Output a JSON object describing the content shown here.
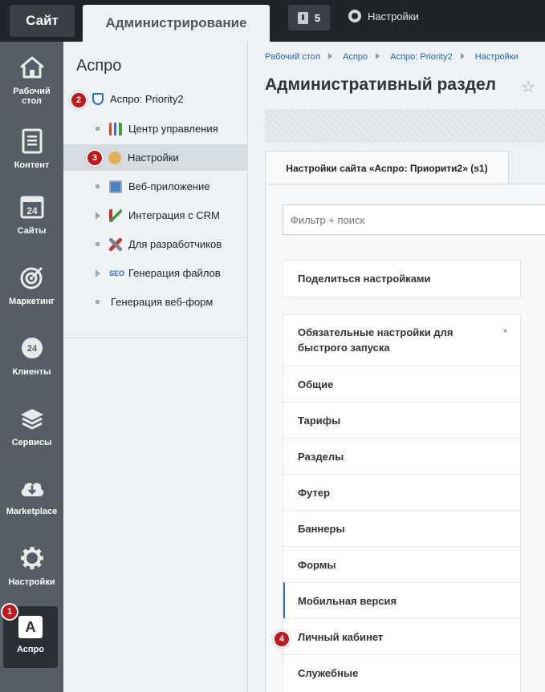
{
  "topbar": {
    "site_tab": "Сайт",
    "admin_tab": "Администрирование",
    "notifications_count": "5",
    "settings_label": "Настройки"
  },
  "leftnav": {
    "items": [
      {
        "label": "Рабочий стол",
        "icon": "home-icon"
      },
      {
        "label": "Контент",
        "icon": "document-icon"
      },
      {
        "label": "Сайты",
        "icon": "calendar-24-icon"
      },
      {
        "label": "Маркетинг",
        "icon": "target-icon"
      },
      {
        "label": "Клиенты",
        "icon": "clients-24-icon"
      },
      {
        "label": "Сервисы",
        "icon": "layers-icon"
      },
      {
        "label": "Marketplace",
        "icon": "cloud-download-icon"
      },
      {
        "label": "Настройки",
        "icon": "gear-icon"
      },
      {
        "label": "Аспро",
        "icon": "aspro-a-icon"
      }
    ],
    "active_label_line": "Аспро",
    "aspro_letter": "A"
  },
  "sub": {
    "title": "Аспро",
    "items": [
      {
        "label": "Аспро: Priority2"
      },
      {
        "label": "Центр управления"
      },
      {
        "label": "Настройки"
      },
      {
        "label": "Веб-приложение"
      },
      {
        "label": "Интеграция с CRM"
      },
      {
        "label": "Для разработчиков"
      },
      {
        "label": "Генерация файлов"
      },
      {
        "label": "Генерация веб-форм"
      }
    ]
  },
  "main": {
    "breadcrumbs": [
      "Рабочий стол",
      "Аспро",
      "Аспро: Priority2",
      "Настройки"
    ],
    "title": "Административный раздел",
    "site_tab": "Настройки сайта «Аспро: Приорити2» (s1)",
    "search_placeholder": "Фильтр + поиск",
    "share_label": "Поделиться настройками",
    "required_star": "*",
    "sections": [
      "Обязательные настройки для быстрого запуска",
      "Общие",
      "Тарифы",
      "Разделы",
      "Футер",
      "Баннеры",
      "Формы",
      "Мобильная версия",
      "Личный кабинет",
      "Служебные"
    ]
  },
  "badges": [
    "1",
    "2",
    "3",
    "4"
  ],
  "colors": {
    "accent": "#2e6fba",
    "badge": "#c0181c",
    "sidebar": "#565d66",
    "topbar": "#1f2429"
  }
}
